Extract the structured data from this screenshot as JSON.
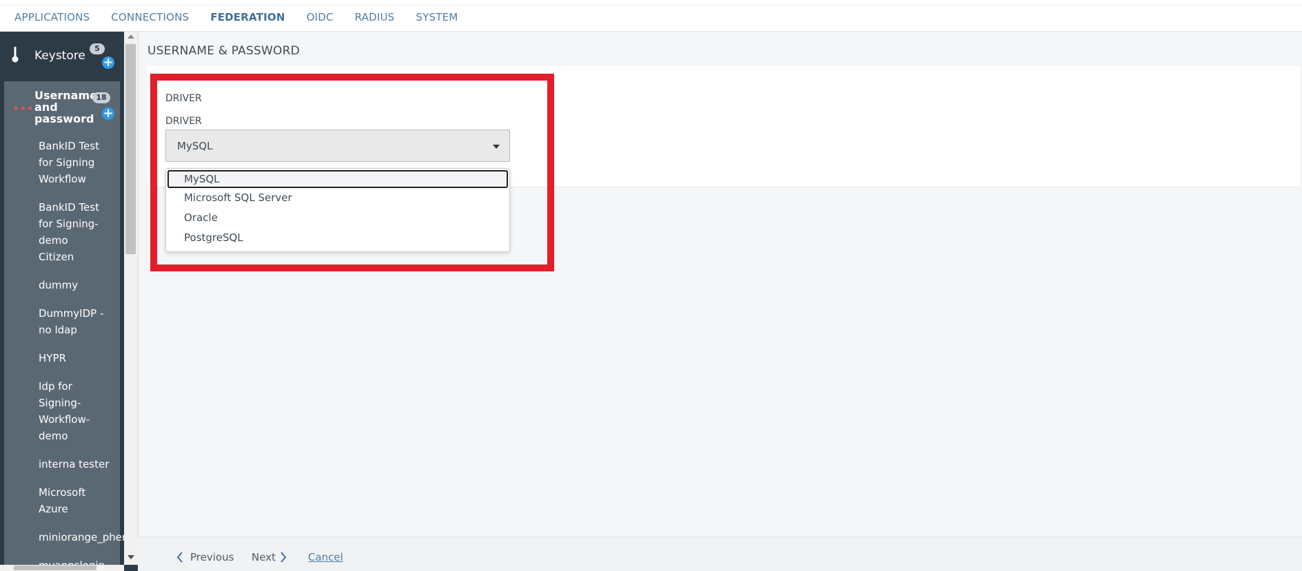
{
  "nav": {
    "items": [
      "APPLICATIONS",
      "CONNECTIONS",
      "FEDERATION",
      "OIDC",
      "RADIUS",
      "SYSTEM"
    ],
    "active": "FEDERATION"
  },
  "sidebar": {
    "keystore": {
      "label": "Keystore",
      "count": "5"
    },
    "group": {
      "label": "Username and password",
      "count": "18"
    },
    "items": [
      "BankID Test for Signing Workflow",
      "BankID Test for Signing-demo Citizen",
      "dummy",
      "DummyIDP - no ldap",
      "HYPR",
      "Idp for Signing-Workflow-demo",
      "interna tester",
      "Microsoft Azure",
      "miniorange_phen",
      "myappslogin"
    ]
  },
  "main": {
    "title": "USERNAME & PASSWORD",
    "section_label": "DRIVER",
    "field_label": "DRIVER",
    "select_value": "MySQL",
    "options": [
      "MySQL",
      "Microsoft SQL Server",
      "Oracle",
      "PostgreSQL"
    ]
  },
  "footer": {
    "previous": "Previous",
    "next": "Next",
    "cancel": "Cancel"
  },
  "colors": {
    "accent": "#4f7ea6",
    "highlight": "#e11e2a",
    "sidebar_bg": "#2c3a46",
    "plus": "#2e9af0"
  }
}
